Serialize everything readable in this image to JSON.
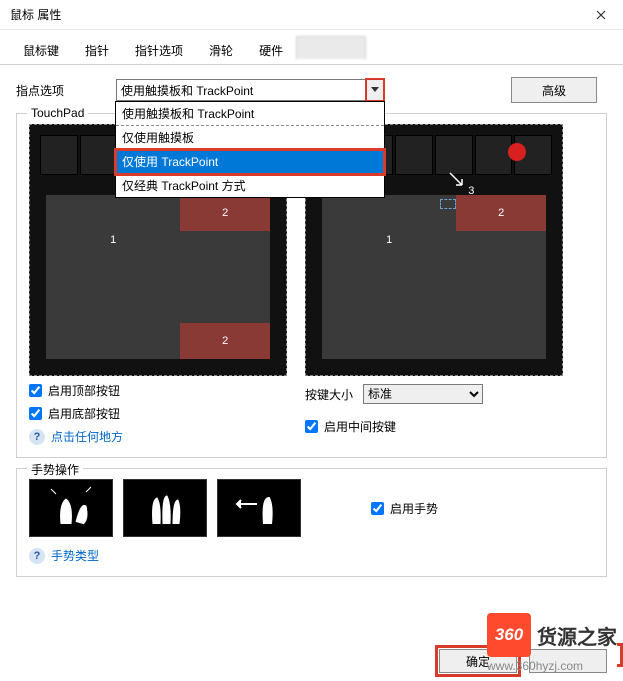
{
  "window": {
    "title": "鼠标 属性"
  },
  "tabs": [
    "鼠标键",
    "指针",
    "指针选项",
    "滑轮",
    "硬件"
  ],
  "pointing": {
    "label": "指点选项",
    "selected": "使用触摸板和 TrackPoint",
    "options": [
      "使用触摸板和 TrackPoint",
      "仅使用触摸板",
      "仅使用 TrackPoint",
      "仅经典 TrackPoint 方式"
    ],
    "highlight_index": 2
  },
  "advanced": "高级",
  "touchpad": {
    "legend": "TouchPad",
    "zone1": "1",
    "zone2": "2",
    "zone3": "3",
    "enable_top": "启用顶部按钮",
    "enable_bottom": "启用底部按钮",
    "click_anywhere": "点击任何地方",
    "size_label": "按键大小",
    "size_value": "标准",
    "enable_middle": "启用中间按键"
  },
  "gestures": {
    "legend": "手势操作",
    "enable": "启用手势",
    "types": "手势类型"
  },
  "buttons": {
    "ok": "确定"
  },
  "watermark": {
    "logo": "360",
    "text": "货源之家",
    "url": "www.360hyzj.com"
  }
}
